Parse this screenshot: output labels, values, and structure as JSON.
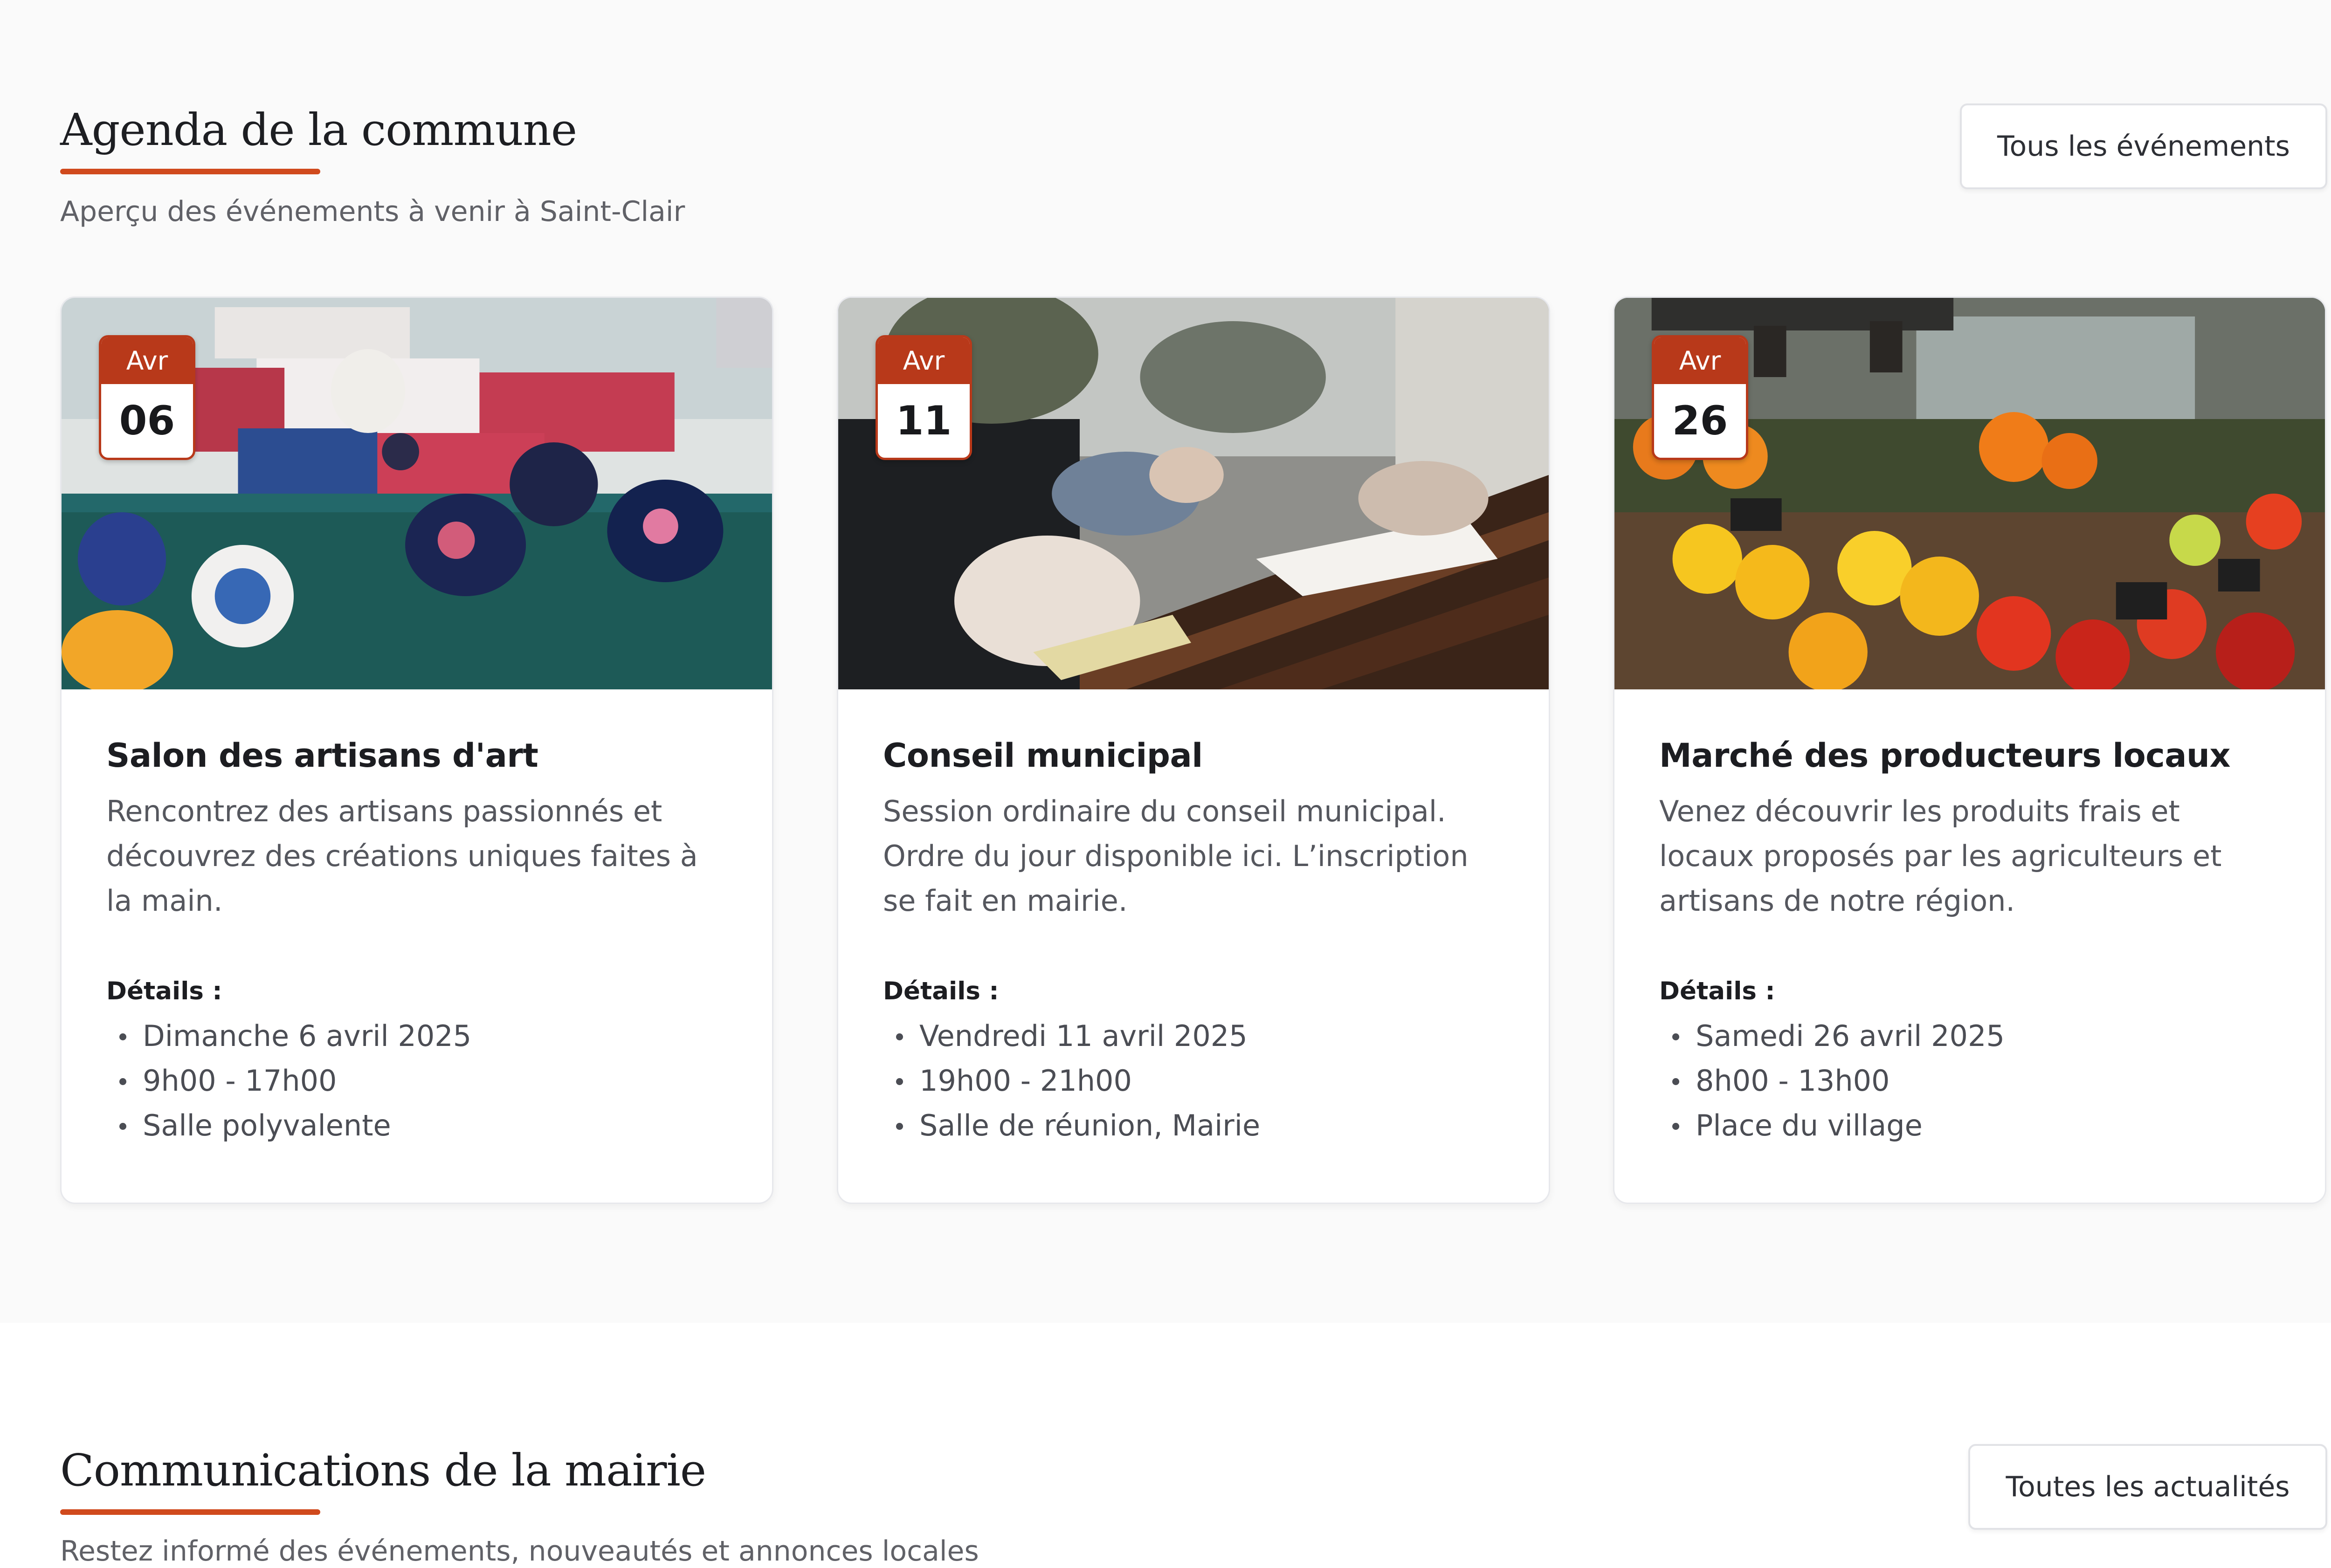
{
  "agenda": {
    "title": "Agenda de la commune",
    "subtitle": "Aperçu des événements à venir à Saint-Clair",
    "all_button": "Tous les événements",
    "cards": [
      {
        "month": "Avr",
        "day": "06",
        "title": "Salon des artisans d'art",
        "description": "Rencontrez des artisans passionnés et découvrez des créations uniques faites à la main.",
        "details_label": "Détails :",
        "details": [
          "Dimanche 6 avril 2025",
          "9h00 - 17h00",
          "Salle polyvalente"
        ]
      },
      {
        "month": "Avr",
        "day": "11",
        "title": "Conseil municipal",
        "description": "Session ordinaire du conseil municipal. Ordre du jour disponible ici. L’inscription se fait en mairie.",
        "details_label": "Détails :",
        "details": [
          "Vendredi 11 avril 2025",
          "19h00 - 21h00",
          "Salle de réunion, Mairie"
        ]
      },
      {
        "month": "Avr",
        "day": "26",
        "title": "Marché des producteurs locaux",
        "description": "Venez découvrir les produits frais et locaux proposés par les agriculteurs et artisans de notre région.",
        "details_label": "Détails :",
        "details": [
          "Samedi 26 avril 2025",
          "8h00 - 13h00",
          "Place du village"
        ]
      }
    ]
  },
  "communications": {
    "title": "Communications de la mairie",
    "subtitle": "Restez informé des événements, nouveautés et annonces locales",
    "all_button": "Toutes les actualités"
  },
  "colors": {
    "accent": "#d04a1d",
    "badge": "#b8391a",
    "page_background": "#fafafa"
  }
}
